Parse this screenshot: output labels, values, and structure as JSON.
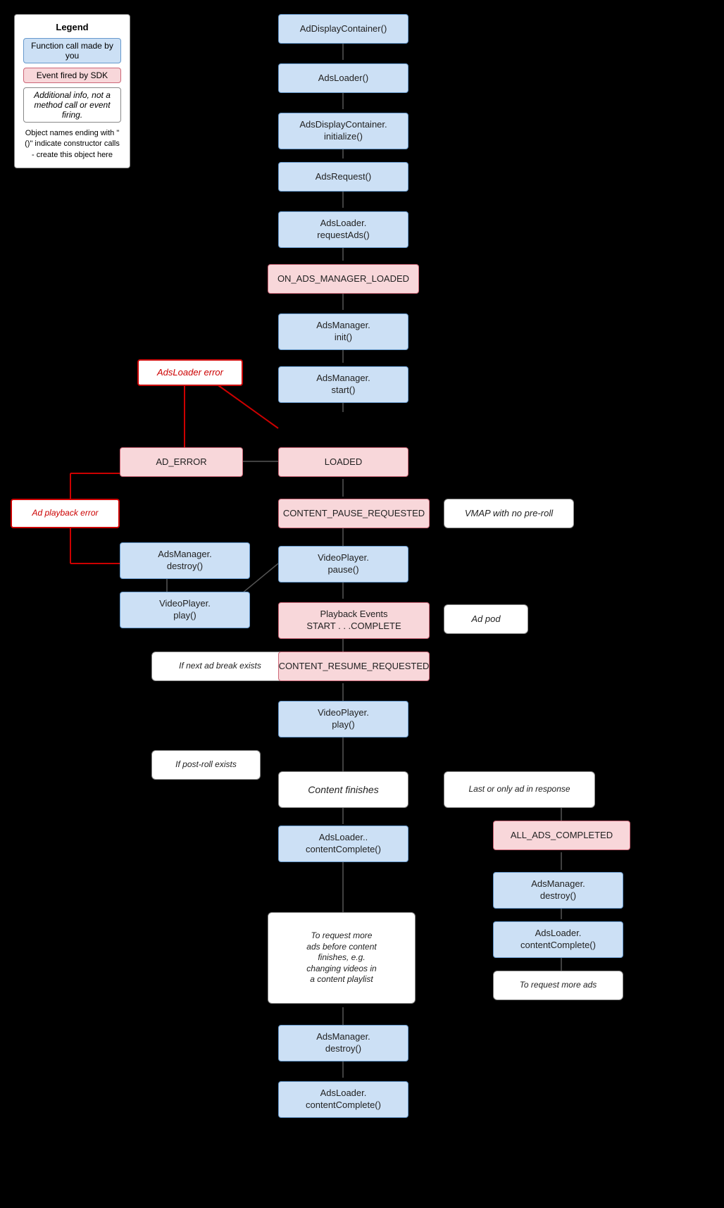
{
  "legend": {
    "title": "Legend",
    "items": [
      {
        "type": "blue",
        "label": "Function call made by you"
      },
      {
        "type": "pink",
        "label": "Event fired by SDK"
      },
      {
        "type": "italic",
        "label": "Additional info, not a method call or event firing."
      }
    ],
    "note": "Object names ending with \"()\" indicate constructor calls - create this object here"
  },
  "nodes": {
    "adDisplayContainer": "AdDisplayContainer()",
    "adsLoader": "AdsLoader()",
    "adsDisplayContainerInit": "AdsDisplayContainer.\ninitialize()",
    "adsRequest": "AdsRequest()",
    "adsLoaderRequestAds": "AdsLoader.\nrequestAds()",
    "onAdsManagerLoaded": "ON_ADS_MANAGER_LOADED",
    "adsManagerInit": "AdsManager.\ninit()",
    "adsLoaderError": "AdsLoader error",
    "adsManagerStart": "AdsManager.\nstart()",
    "adError": "AD_ERROR",
    "loaded": "LOADED",
    "adsManagerDestroy1": "AdsManager.\ndestroy()",
    "contentPauseRequested": "CONTENT_PAUSE_REQUESTED",
    "vmapNoPre": "VMAP with no pre-roll",
    "videoPlayerPlay1": "VideoPlayer.\nplay()",
    "videoPlayerPause": "VideoPlayer.\npause()",
    "adPlaybackError": "Ad playback error",
    "playbackEvents": "Playback Events\nSTART . . .COMPLETE",
    "adPod": "Ad pod",
    "ifNextAdBreak": "If next ad break exists",
    "contentResumeRequested": "CONTENT_RESUME_REQUESTED",
    "videoPlayerPlay2": "VideoPlayer.\nplay()",
    "ifPostRoll": "If post-roll exists",
    "contentFinishes": "Content finishes",
    "lastOrOnly": "Last or only ad in response",
    "allAdsCompleted": "ALL_ADS_COMPLETED",
    "adsLoaderContentComplete1": "AdsLoader..\ncontentComplete()",
    "adsManagerDestroy2": "AdsManager.\ndestroy()",
    "adsLoaderContentComplete2": "AdsLoader.\ncontentComplete()",
    "toRequestMoreAds": "To request more ads",
    "toRequestMoreAdsBefore": "To request more\nads before content\nfinishes, e.g.\nchanging videos in\na content playlist",
    "adsManagerDestroy3": "AdsManager.\ndestroy()",
    "adsLoaderContentComplete3": "AdsLoader.\ncontentComplete()"
  }
}
